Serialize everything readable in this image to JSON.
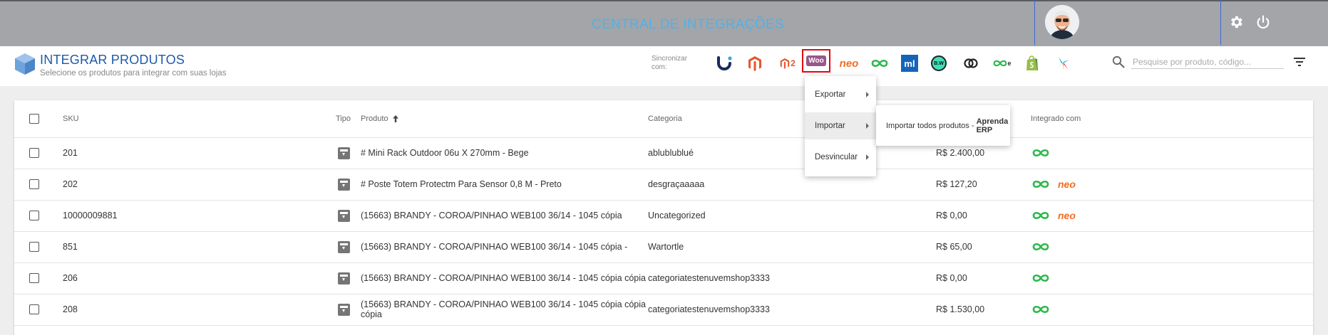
{
  "topbar": {
    "title": "CENTRAL DE INTEGRAÇÕES",
    "title_color": "#4db2ec",
    "bg_color": "#a3a5a9",
    "icons": [
      "avatar",
      "gear-icon",
      "power-icon"
    ]
  },
  "header": {
    "title": "INTEGRAR PRODUTOS",
    "subtitle": "Selecione os produtos para integrar com suas lojas",
    "sync_label": "Sincronizar com:",
    "integrations": [
      {
        "name": "u-logo-icon",
        "text": ""
      },
      {
        "name": "magento-icon",
        "text": ""
      },
      {
        "name": "magento2-icon",
        "text": "2"
      },
      {
        "name": "woocommerce-icon",
        "text": "Woo",
        "selected": true
      },
      {
        "name": "neo-icon",
        "text": "neo"
      },
      {
        "name": "infinity-icon",
        "text": ""
      },
      {
        "name": "mercadolivre-icon",
        "text": "ml"
      },
      {
        "name": "bw-icon",
        "text": "B.W"
      },
      {
        "name": "link-icon",
        "text": ""
      },
      {
        "name": "infinity-e-icon",
        "text": "e"
      },
      {
        "name": "shopify-icon",
        "text": ""
      },
      {
        "name": "star-logo-icon",
        "text": ""
      }
    ],
    "search_placeholder": "Pesquise por produto, código...",
    "accent_color": "#1e5aa8"
  },
  "table": {
    "columns": {
      "sku": "SKU",
      "tipo": "Tipo",
      "produto": "Produto",
      "categoria": "Categoria",
      "integrado": "Integrado com"
    },
    "sort_column": "produto",
    "sort_direction": "asc",
    "rows": [
      {
        "sku": "201",
        "produto": "# Mini Rack Outdoor 06u X 270mm - Bege",
        "categoria": "ablublublué",
        "preco": "R$ 2.400,00",
        "integracoes": [
          "infinity"
        ]
      },
      {
        "sku": "202",
        "produto": "# Poste Totem Protectm Para Sensor 0,8 M - Preto",
        "categoria": "desgraçaaaaa",
        "preco": "R$ 127,20",
        "integracoes": [
          "infinity",
          "neo"
        ]
      },
      {
        "sku": "10000009881",
        "produto": "(15663) BRANDY - COROA/PINHAO WEB100 36/14 - 1045 cópia",
        "categoria": "Uncategorized",
        "preco": "R$ 0,00",
        "integracoes": [
          "infinity",
          "neo"
        ]
      },
      {
        "sku": "851",
        "produto": "(15663) BRANDY - COROA/PINHAO WEB100 36/14 - 1045 cópia -",
        "categoria": "Wartortle",
        "preco": "R$ 65,00",
        "integracoes": [
          "infinity"
        ]
      },
      {
        "sku": "206",
        "produto": "(15663) BRANDY - COROA/PINHAO WEB100 36/14 - 1045 cópia cópia",
        "categoria": "categoriatestenuvemshop3333",
        "preco": "R$ 0,00",
        "integracoes": [
          "infinity"
        ]
      },
      {
        "sku": "208",
        "produto": "(15663) BRANDY - COROA/PINHAO WEB100 36/14 - 1045 cópia cópia cópia",
        "categoria": "categoriatestenuvemshop3333",
        "preco": "R$ 1.530,00",
        "integracoes": [
          "infinity"
        ]
      }
    ]
  },
  "menu": {
    "items": [
      {
        "label": "Exportar"
      },
      {
        "label": "Importar",
        "active": true
      },
      {
        "label": "Desvincular"
      }
    ],
    "submenu": {
      "prefix": "Importar todos produtos - ",
      "bold": "Aprenda ERP"
    }
  },
  "colors": {
    "infinity": "#2db84c",
    "neo": "#f26c22",
    "woo": "#96588a",
    "magento": "#e4572e",
    "ml": "#1564b8",
    "shopify": "#95bf47",
    "selected_border": "#e30613"
  }
}
